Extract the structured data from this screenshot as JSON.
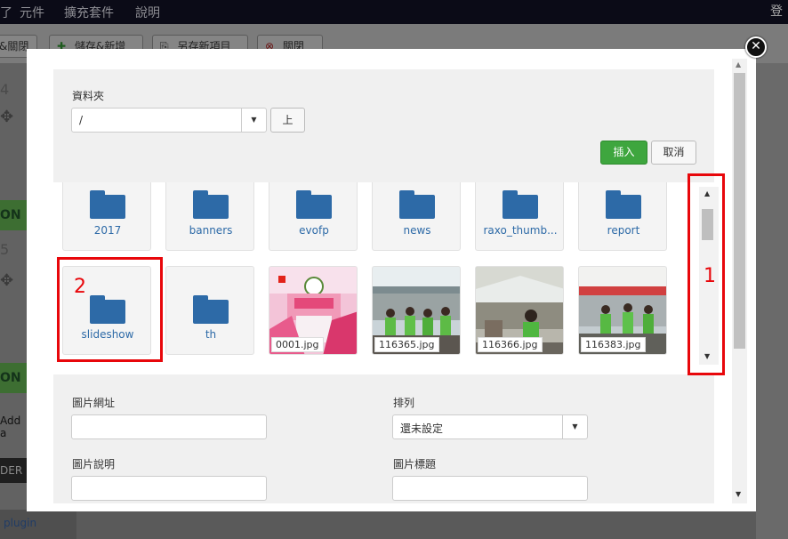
{
  "background": {
    "menu": [
      "元件",
      "擴充套件",
      "說明"
    ],
    "menu_left_fragment": "了",
    "top_right_fragment": "登",
    "toolbar": {
      "save_close_fragment": "&關閉",
      "save_new": "儲存&新增",
      "save_as": "另存新項目",
      "close": "關閉"
    },
    "side": {
      "num_a": "4",
      "num_b": "5",
      "on_label": "ON",
      "add_fragment": "Add a",
      "der_fragment": "DER",
      "plugin_fragment": "plugin"
    }
  },
  "modal": {
    "folder_label": "資料夾",
    "folder_value": "/",
    "up_button": "上",
    "insert_button": "插入",
    "cancel_button": "取消",
    "items": [
      {
        "type": "folder",
        "name": "2017"
      },
      {
        "type": "folder",
        "name": "banners"
      },
      {
        "type": "folder",
        "name": "evofp"
      },
      {
        "type": "folder",
        "name": "news"
      },
      {
        "type": "folder",
        "name": "raxo_thumb..."
      },
      {
        "type": "folder",
        "name": "report"
      },
      {
        "type": "folder",
        "name": "slideshow"
      },
      {
        "type": "folder",
        "name": "th"
      },
      {
        "type": "image",
        "name": "0001.jpg"
      },
      {
        "type": "image",
        "name": "116365.jpg"
      },
      {
        "type": "image",
        "name": "116366.jpg"
      },
      {
        "type": "image",
        "name": "116383.jpg"
      }
    ],
    "form": {
      "image_url_label": "圖片網址",
      "image_url_value": "",
      "sort_label": "排列",
      "sort_value": "還未設定",
      "image_desc_label": "圖片說明",
      "image_desc_value": "",
      "image_title_label": "圖片標題",
      "image_title_value": ""
    }
  },
  "annotations": {
    "box1_number": "1",
    "box2_number": "2",
    "color": "#e8070b"
  }
}
